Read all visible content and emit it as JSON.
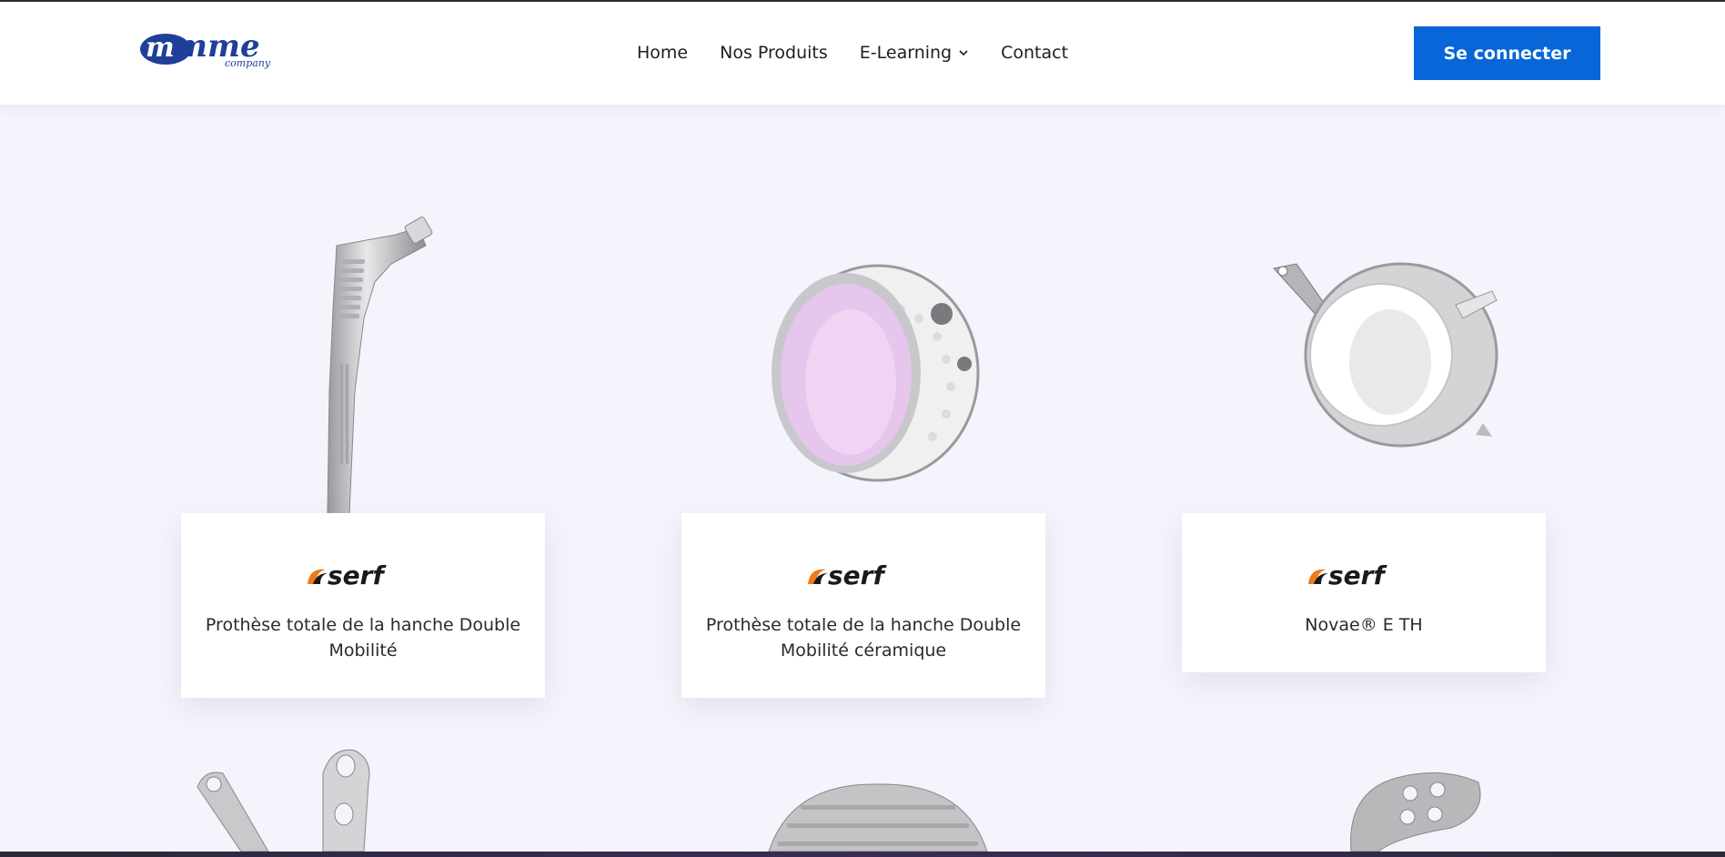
{
  "header": {
    "logo_text": "mme",
    "logo_subtext": "company",
    "nav": [
      {
        "label": "Home"
      },
      {
        "label": "Nos Produits"
      },
      {
        "label": "E-Learning"
      },
      {
        "label": "Contact"
      }
    ],
    "login_label": "Se connecter"
  },
  "brand_logo_text": "serf",
  "products": [
    {
      "title": "Prothèse totale de la hanche Double Mobilité",
      "brand": "serf"
    },
    {
      "title": "Prothèse totale de la hanche Double Mobilité céramique",
      "brand": "serf"
    },
    {
      "title": "Novae® E TH",
      "brand": "serf"
    }
  ],
  "colors": {
    "accent": "#0866d9",
    "background": "#f4f4fc",
    "brand_orange": "#f07a1a",
    "logo_blue": "#1f3f9a"
  }
}
